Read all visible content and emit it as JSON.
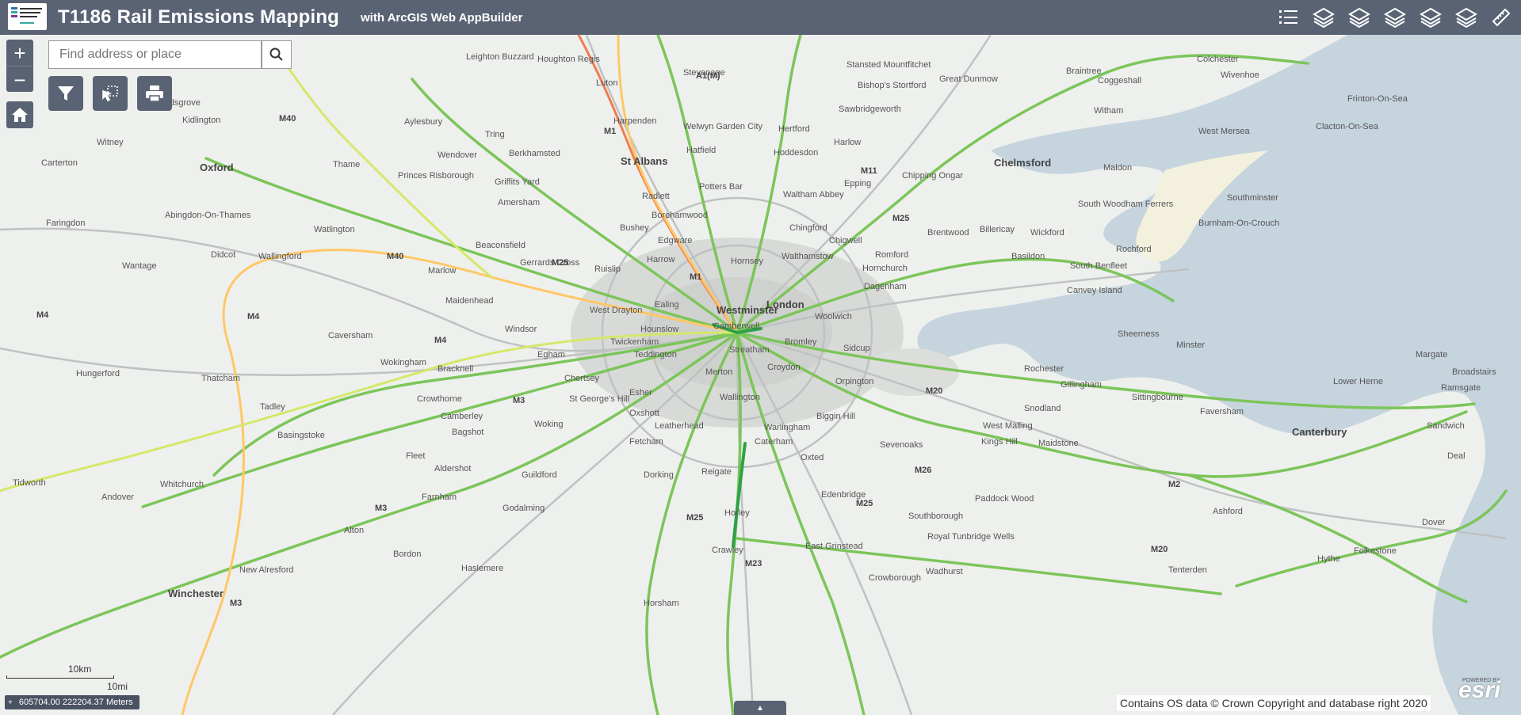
{
  "header": {
    "title": "T1186 Rail Emissions Mapping",
    "subtitle": "with ArcGIS Web AppBuilder",
    "logo_icon": "rssb-logo",
    "widgets": [
      {
        "name": "legend-icon"
      },
      {
        "name": "layer-list-icon"
      },
      {
        "name": "layer-list-icon"
      },
      {
        "name": "layer-list-icon"
      },
      {
        "name": "layer-list-icon"
      },
      {
        "name": "layer-list-icon"
      },
      {
        "name": "measure-icon"
      }
    ]
  },
  "search": {
    "placeholder": "Find address or place",
    "value": ""
  },
  "zoom": {
    "in": "+",
    "out": "−"
  },
  "scalebar": {
    "km": "10km",
    "mi": "10mi"
  },
  "coordinates": "605704.00 222204.37 Meters",
  "attribution": "Contains OS data © Crown Copyright and database right 2020",
  "esri": {
    "powered": "POWERED BY",
    "brand": "esri"
  },
  "colors": {
    "header": "#5a6374",
    "rail_low": "#7cc55a",
    "rail_mid": "#d4e86a",
    "rail_orange": "#ffc766",
    "rail_high": "#f07d4d",
    "rail_dark": "#2ea14a",
    "sea": "#c4d3dd",
    "land": "#eef0ed"
  },
  "places": [
    {
      "text": "St Albans",
      "cls": "big"
    },
    {
      "text": "Chelmsford",
      "cls": "big"
    },
    {
      "text": "Oxford",
      "cls": "big"
    },
    {
      "text": "Westminster",
      "cls": "big"
    },
    {
      "text": "London",
      "cls": "big"
    },
    {
      "text": "Canterbury",
      "cls": "big"
    },
    {
      "text": "Winchester",
      "cls": "big"
    },
    {
      "text": "Luton",
      "cls": ""
    },
    {
      "text": "Harpenden",
      "cls": ""
    },
    {
      "text": "Welwyn Garden City",
      "cls": ""
    },
    {
      "text": "Hertford",
      "cls": ""
    },
    {
      "text": "Hoddesdon",
      "cls": ""
    },
    {
      "text": "Harlow",
      "cls": ""
    },
    {
      "text": "Bishop's Stortford",
      "cls": ""
    },
    {
      "text": "Sawbridgeworth",
      "cls": ""
    },
    {
      "text": "Great Dunmow",
      "cls": ""
    },
    {
      "text": "Braintree",
      "cls": ""
    },
    {
      "text": "Coggeshall",
      "cls": ""
    },
    {
      "text": "Colchester",
      "cls": ""
    },
    {
      "text": "Wivenhoe",
      "cls": ""
    },
    {
      "text": "Frinton-On-Sea",
      "cls": ""
    },
    {
      "text": "Clacton-On-Sea",
      "cls": ""
    },
    {
      "text": "Witham",
      "cls": ""
    },
    {
      "text": "West Mersea",
      "cls": ""
    },
    {
      "text": "Maldon",
      "cls": ""
    },
    {
      "text": "South Woodham Ferrers",
      "cls": ""
    },
    {
      "text": "Southminster",
      "cls": ""
    },
    {
      "text": "Burnham-On-Crouch",
      "cls": ""
    },
    {
      "text": "Chipping Ongar",
      "cls": ""
    },
    {
      "text": "Epping",
      "cls": ""
    },
    {
      "text": "Brentwood",
      "cls": ""
    },
    {
      "text": "Billericay",
      "cls": ""
    },
    {
      "text": "Wickford",
      "cls": ""
    },
    {
      "text": "Rochford",
      "cls": ""
    },
    {
      "text": "Basildon",
      "cls": ""
    },
    {
      "text": "South Benfleet",
      "cls": ""
    },
    {
      "text": "Canvey Island",
      "cls": ""
    },
    {
      "text": "Romford",
      "cls": ""
    },
    {
      "text": "Hornchurch",
      "cls": ""
    },
    {
      "text": "Dagenham",
      "cls": ""
    },
    {
      "text": "Chigwell",
      "cls": ""
    },
    {
      "text": "Chingford",
      "cls": ""
    },
    {
      "text": "Waltham Abbey",
      "cls": ""
    },
    {
      "text": "Potters Bar",
      "cls": ""
    },
    {
      "text": "Hatfield",
      "cls": ""
    },
    {
      "text": "Radlett",
      "cls": ""
    },
    {
      "text": "Borehamwood",
      "cls": ""
    },
    {
      "text": "Bushey",
      "cls": ""
    },
    {
      "text": "Edgware",
      "cls": ""
    },
    {
      "text": "Harrow",
      "cls": ""
    },
    {
      "text": "Hornsey",
      "cls": ""
    },
    {
      "text": "Walthamstow",
      "cls": ""
    },
    {
      "text": "Ealing",
      "cls": ""
    },
    {
      "text": "Hounslow",
      "cls": ""
    },
    {
      "text": "West Drayton",
      "cls": ""
    },
    {
      "text": "Ruislip",
      "cls": ""
    },
    {
      "text": "Gerrards Cross",
      "cls": ""
    },
    {
      "text": "Amersham",
      "cls": ""
    },
    {
      "text": "Berkhamsted",
      "cls": ""
    },
    {
      "text": "Tring",
      "cls": ""
    },
    {
      "text": "Wendover",
      "cls": ""
    },
    {
      "text": "Aylesbury",
      "cls": ""
    },
    {
      "text": "Princes Risborough",
      "cls": ""
    },
    {
      "text": "Thame",
      "cls": ""
    },
    {
      "text": "Griffits Yard",
      "cls": ""
    },
    {
      "text": "Beaconsfield",
      "cls": ""
    },
    {
      "text": "Marlow",
      "cls": ""
    },
    {
      "text": "Maidenhead",
      "cls": ""
    },
    {
      "text": "Windsor",
      "cls": ""
    },
    {
      "text": "Egham",
      "cls": ""
    },
    {
      "text": "Teddington",
      "cls": ""
    },
    {
      "text": "Twickenham",
      "cls": ""
    },
    {
      "text": "Woolwich",
      "cls": ""
    },
    {
      "text": "Camberwell",
      "cls": ""
    },
    {
      "text": "Streatham",
      "cls": ""
    },
    {
      "text": "Bromley",
      "cls": ""
    },
    {
      "text": "Sidcup",
      "cls": ""
    },
    {
      "text": "Orpington",
      "cls": ""
    },
    {
      "text": "Croydon",
      "cls": ""
    },
    {
      "text": "Merton",
      "cls": ""
    },
    {
      "text": "Wallington",
      "cls": ""
    },
    {
      "text": "Esher",
      "cls": ""
    },
    {
      "text": "Oxshott",
      "cls": ""
    },
    {
      "text": "Chertsey",
      "cls": ""
    },
    {
      "text": "Woking",
      "cls": ""
    },
    {
      "text": "St George's Hill",
      "cls": ""
    },
    {
      "text": "Leatherhead",
      "cls": ""
    },
    {
      "text": "Fetcham",
      "cls": ""
    },
    {
      "text": "Dorking",
      "cls": ""
    },
    {
      "text": "Reigate",
      "cls": ""
    },
    {
      "text": "Caterham",
      "cls": ""
    },
    {
      "text": "Warlingham",
      "cls": ""
    },
    {
      "text": "Biggin Hill",
      "cls": ""
    },
    {
      "text": "Oxted",
      "cls": ""
    },
    {
      "text": "Sevenoaks",
      "cls": ""
    },
    {
      "text": "Kings Hill",
      "cls": ""
    },
    {
      "text": "Maidstone",
      "cls": ""
    },
    {
      "text": "Snodland",
      "cls": ""
    },
    {
      "text": "Gillingham",
      "cls": ""
    },
    {
      "text": "Rochester",
      "cls": ""
    },
    {
      "text": "Sittingbourne",
      "cls": ""
    },
    {
      "text": "Sheerness",
      "cls": ""
    },
    {
      "text": "Minster",
      "cls": ""
    },
    {
      "text": "Margate",
      "cls": ""
    },
    {
      "text": "Broadstairs",
      "cls": ""
    },
    {
      "text": "Ramsgate",
      "cls": ""
    },
    {
      "text": "Lower Herne",
      "cls": ""
    },
    {
      "text": "Faversham",
      "cls": ""
    },
    {
      "text": "Sandwich",
      "cls": ""
    },
    {
      "text": "Deal",
      "cls": ""
    },
    {
      "text": "Dover",
      "cls": ""
    },
    {
      "text": "Folkestone",
      "cls": ""
    },
    {
      "text": "Hythe",
      "cls": ""
    },
    {
      "text": "Tenterden",
      "cls": ""
    },
    {
      "text": "Ashford",
      "cls": ""
    },
    {
      "text": "Paddock Wood",
      "cls": ""
    },
    {
      "text": "West Malling",
      "cls": ""
    },
    {
      "text": "Southborough",
      "cls": ""
    },
    {
      "text": "Royal Tunbridge Wells",
      "cls": ""
    },
    {
      "text": "Wadhurst",
      "cls": ""
    },
    {
      "text": "Crowborough",
      "cls": ""
    },
    {
      "text": "East Grinstead",
      "cls": ""
    },
    {
      "text": "Edenbridge",
      "cls": ""
    },
    {
      "text": "Horley",
      "cls": ""
    },
    {
      "text": "Crawley",
      "cls": ""
    },
    {
      "text": "Horsham",
      "cls": ""
    },
    {
      "text": "Haslemere",
      "cls": ""
    },
    {
      "text": "Godalming",
      "cls": ""
    },
    {
      "text": "Guildford",
      "cls": ""
    },
    {
      "text": "Farnham",
      "cls": ""
    },
    {
      "text": "Aldershot",
      "cls": ""
    },
    {
      "text": "Fleet",
      "cls": ""
    },
    {
      "text": "Camberley",
      "cls": ""
    },
    {
      "text": "Bagshot",
      "cls": ""
    },
    {
      "text": "Crowthorne",
      "cls": ""
    },
    {
      "text": "Bracknell",
      "cls": ""
    },
    {
      "text": "Wokingham",
      "cls": ""
    },
    {
      "text": "Caversham",
      "cls": ""
    },
    {
      "text": "Basingstoke",
      "cls": ""
    },
    {
      "text": "Tadley",
      "cls": ""
    },
    {
      "text": "Thatcham",
      "cls": ""
    },
    {
      "text": "Hungerford",
      "cls": ""
    },
    {
      "text": "Whitchurch",
      "cls": ""
    },
    {
      "text": "Andover",
      "cls": ""
    },
    {
      "text": "Tidworth",
      "cls": ""
    },
    {
      "text": "Alton",
      "cls": ""
    },
    {
      "text": "Bordon",
      "cls": ""
    },
    {
      "text": "New Alresford",
      "cls": ""
    },
    {
      "text": "Wallingford",
      "cls": ""
    },
    {
      "text": "Didcot",
      "cls": ""
    },
    {
      "text": "Wantage",
      "cls": ""
    },
    {
      "text": "Abingdon-On-Thames",
      "cls": ""
    },
    {
      "text": "Faringdon",
      "cls": ""
    },
    {
      "text": "Watlington",
      "cls": ""
    },
    {
      "text": "Kidlington",
      "cls": ""
    },
    {
      "text": "Witney",
      "cls": ""
    },
    {
      "text": "Carterton",
      "cls": ""
    },
    {
      "text": "Leighton Buzzard",
      "cls": ""
    },
    {
      "text": "Houghton Regis",
      "cls": ""
    },
    {
      "text": "Stevenage",
      "cls": ""
    },
    {
      "text": "Stansted Mountfitchet",
      "cls": ""
    },
    {
      "text": "Kidsgrove",
      "cls": ""
    },
    {
      "text": "M1",
      "cls": "motor"
    },
    {
      "text": "M11",
      "cls": "motor"
    },
    {
      "text": "M25",
      "cls": "motor"
    },
    {
      "text": "M40",
      "cls": "motor"
    },
    {
      "text": "M4",
      "cls": "motor"
    },
    {
      "text": "M3",
      "cls": "motor"
    },
    {
      "text": "M20",
      "cls": "motor"
    },
    {
      "text": "M23",
      "cls": "motor"
    },
    {
      "text": "M2",
      "cls": "motor"
    },
    {
      "text": "M26",
      "cls": "motor"
    },
    {
      "text": "A1(M)",
      "cls": "motor"
    }
  ]
}
